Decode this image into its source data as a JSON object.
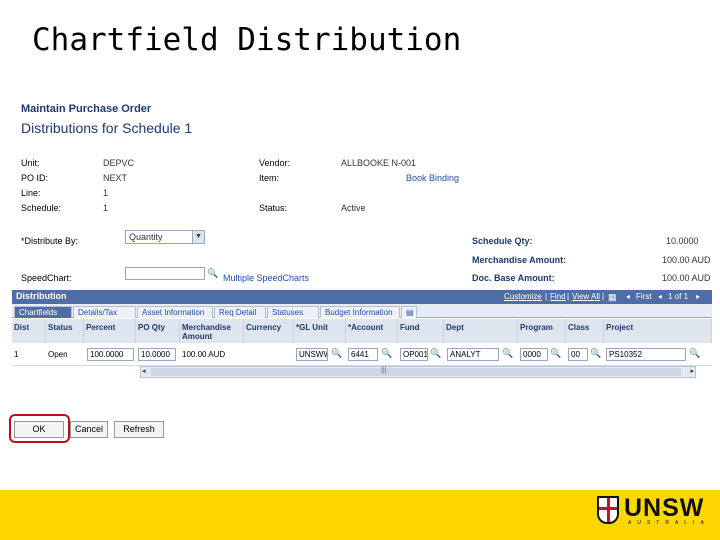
{
  "slide": {
    "title": "Chartfield Distribution"
  },
  "breadcrumb": "Maintain Purchase Order",
  "page_heading": "Distributions for Schedule 1",
  "header_fields": {
    "unit_label": "Unit:",
    "unit_value": "DEPVC",
    "poid_label": "PO ID:",
    "poid_value": "NEXT",
    "line_label": "Line:",
    "line_value": "1",
    "schedule_label": "Schedule:",
    "schedule_value": "1",
    "vendor_label": "Vendor:",
    "vendor_value": "ALLBOOKE N-001",
    "item_label": "Item:",
    "item_value": "Book Binding",
    "status_label": "Status:",
    "status_value": "Active",
    "distribute_label": "*Distribute By:",
    "distribute_value": "Quantity",
    "speedchart_label": "SpeedChart:",
    "multiple_link": "Multiple SpeedCharts",
    "sched_qty_label": "Schedule Qty:",
    "sched_qty_value": "10.0000",
    "merch_amt_label": "Merchandise Amount:",
    "merch_amt_value": "100.00 AUD",
    "doc_base_label": "Doc. Base Amount:",
    "doc_base_value": "100.00 AUD"
  },
  "grid": {
    "title": "Distribution",
    "customize": "Customize",
    "find": "Find",
    "view_all": "View All",
    "first": "First",
    "counter": "1 of 1",
    "tabs": [
      "Chartfields",
      "Details/Tax",
      "Asset Information",
      "Req Detail",
      "Statuses",
      "Budget Information"
    ],
    "columns": [
      "Dist",
      "Status",
      "Percent",
      "PO Qty",
      "Merchandise Amount",
      "Currency",
      "*GL Unit",
      "*Account",
      "Fund",
      "Dept",
      "Program",
      "Class",
      "Project"
    ],
    "row": {
      "dist": "1",
      "status": "Open",
      "percent": "100.0000",
      "po_qty": "10.0000",
      "merch_amount": "100.00 AUD",
      "currency": "",
      "gl_unit": "UNSWW",
      "account": "6441",
      "fund": "OP001",
      "dept": "ANALYT",
      "program": "0000",
      "class": "00",
      "project": "PS10352"
    }
  },
  "buttons": {
    "ok": "OK",
    "cancel": "Cancel",
    "refresh": "Refresh"
  },
  "footer": {
    "brand": "UNSW",
    "brand_sub": "AUSTRALIA",
    "color": "#ffd700"
  }
}
